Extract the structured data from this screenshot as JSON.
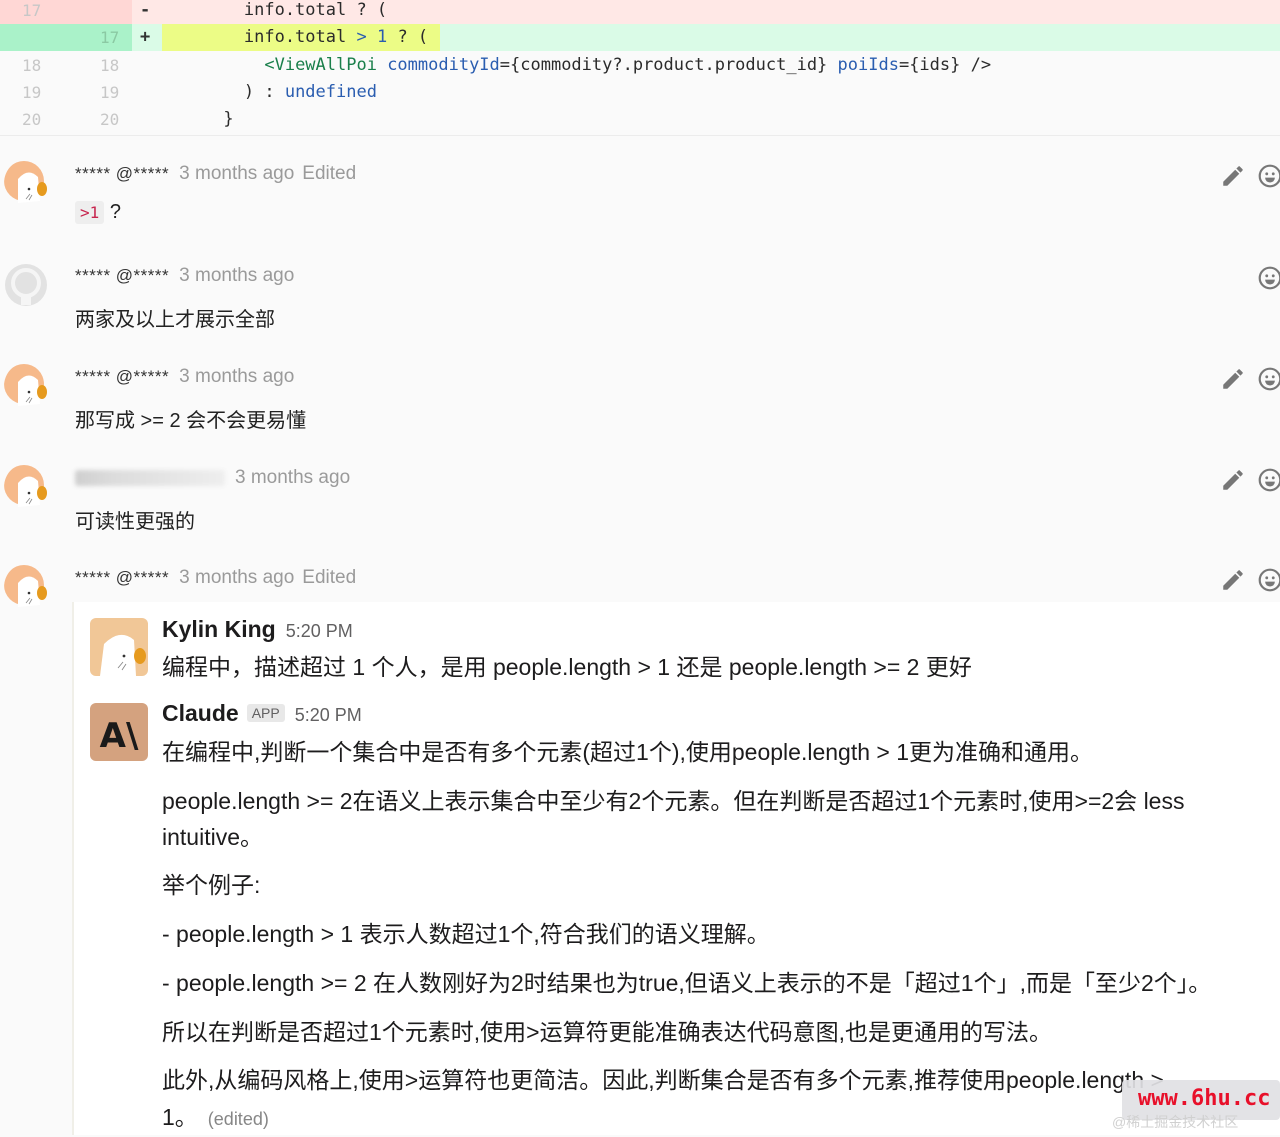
{
  "diff": {
    "lines": [
      {
        "type": "removed",
        "old": "17",
        "new": "",
        "sign": "-",
        "code": "        info.total ? ("
      },
      {
        "type": "added",
        "old": "",
        "new": "17",
        "sign": "+",
        "code_pre": "        info.total ",
        "code_op": ">",
        "code_num": " 1",
        "code_post": " ? ("
      },
      {
        "type": "context",
        "old": "18",
        "new": "18",
        "sign": "",
        "code_indent": "          ",
        "tag": "<ViewAllPoi",
        "attr1": " commodityId",
        "val1": "={commodity?.product.product_id}",
        "attr2": " poiIds",
        "val2": "={ids} />"
      },
      {
        "type": "context",
        "old": "19",
        "new": "19",
        "sign": "",
        "code_pre": "        ) : ",
        "code_kw": "undefined"
      },
      {
        "type": "context",
        "old": "20",
        "new": "20",
        "sign": "",
        "code": "      }"
      }
    ]
  },
  "comments": [
    {
      "author": "***** @*****",
      "time": "3 months ago",
      "edited": "Edited",
      "body_code": ">1",
      "body_text": " ?",
      "has_edit": true
    },
    {
      "author": "***** @*****",
      "time": "3 months ago",
      "edited": "",
      "body_text": "两家及以上才展示全部",
      "has_edit": false
    },
    {
      "author": "***** @*****",
      "time": "3 months ago",
      "edited": "",
      "body_text": "那写成 >= 2 会不会更易懂",
      "has_edit": true
    },
    {
      "author": "",
      "time": "3 months ago",
      "edited": "",
      "body_text": "可读性更强的",
      "has_edit": true,
      "author_redacted": true
    },
    {
      "author": "***** @*****",
      "time": "3 months ago",
      "edited": "Edited",
      "body_text": "",
      "has_edit": true
    }
  ],
  "slack": {
    "messages": [
      {
        "name": "Kylin King",
        "badge": "",
        "time": "5:20 PM",
        "lines": [
          "编程中，描述超过 1 个人，是用 people.length > 1 还是 people.length >= 2 更好"
        ]
      },
      {
        "name": "Claude",
        "badge": "APP",
        "time": "5:20 PM",
        "lines": [
          "在编程中,判断一个集合中是否有多个元素(超过1个),使用people.length > 1更为准确和通用。",
          "people.length >= 2在语义上表示集合中至少有2个元素。但在判断是否超过1个元素时,使用>=2会 less",
          "intuitive。",
          "举个例子:",
          "- people.length > 1 表示人数超过1个,符合我们的语义理解。",
          "- people.length >= 2 在人数刚好为2时结果也为true,但语义上表示的不是「超过1个」,而是「至少2个」。",
          "所以在判断是否超过1个元素时,使用>运算符更能准确表达代码意图,也是更通用的写法。",
          "此外,从编码风格上,使用>运算符也更简洁。因此,判断集合是否有多个元素,推荐使用people.length >",
          "1。"
        ],
        "edited": "(edited)"
      }
    ]
  },
  "watermark": {
    "text": "www.6hu.cc",
    "sub": "@稀土掘金技术社区"
  }
}
